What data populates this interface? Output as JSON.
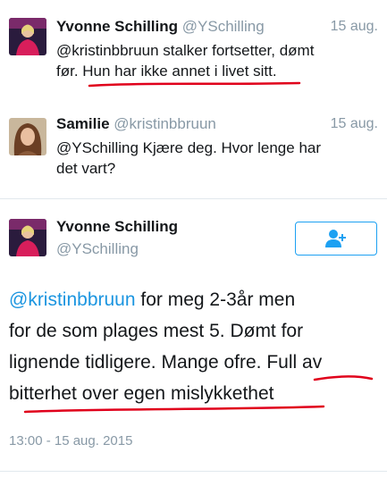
{
  "tweets": [
    {
      "name": "Yvonne Schilling",
      "handle": "@YSchilling",
      "date": "15 aug.",
      "line1": "@kristinbbruun stalker fortsetter, dømt",
      "line2": "før. Hun har ikke annet i livet sitt."
    },
    {
      "name": "Samilie",
      "handle": "@kristinbbruun",
      "date": "15 aug.",
      "line1": "@YSchilling Kjære deg. Hvor lenge har",
      "line2": "det vart?"
    }
  ],
  "main_tweet": {
    "name": "Yvonne Schilling",
    "handle": "@YSchilling",
    "mention": "@kristinbbruun",
    "line1_rest": " for meg 2-3år men",
    "line2": "for de som plages mest 5. Dømt for",
    "line3": "lignende tidligere. Mange ofre. Full av",
    "line4": "bitterhet over egen mislykkethet",
    "timestamp": "13:00 - 15 aug. 2015"
  },
  "colors": {
    "accent": "#1da1f2",
    "mention": "#1b95e0",
    "muted": "#8899a6",
    "annotation": "#e0001b"
  },
  "icons": {
    "follow": "add-user-icon"
  }
}
